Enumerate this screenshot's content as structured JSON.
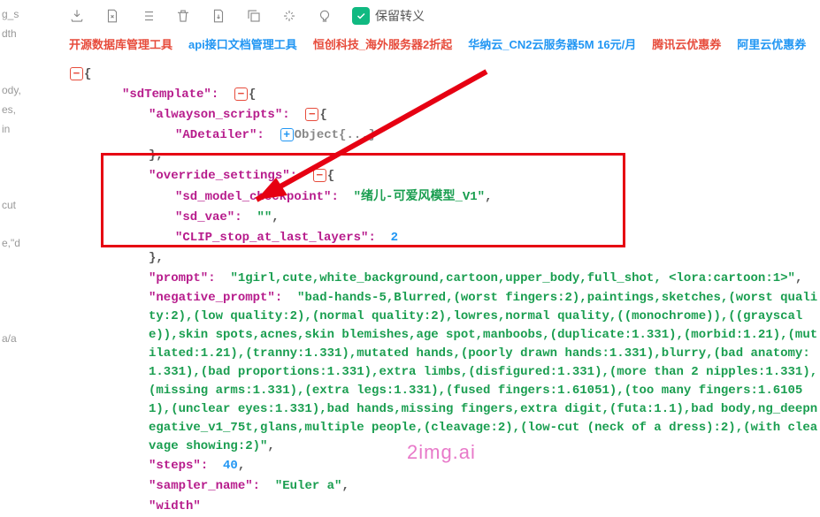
{
  "toolbar": {
    "checkbox_label": "保留转义"
  },
  "links": [
    {
      "text": "开源数据库管理工具",
      "cls": "link-red"
    },
    {
      "text": "api接口文档管理工具",
      "cls": "link-blue"
    },
    {
      "text": "恒创科技_海外服务器2折起",
      "cls": "link-red"
    },
    {
      "text": "华纳云_CN2云服务器5M 16元/月",
      "cls": "link-blue"
    },
    {
      "text": "腾讯云优惠券",
      "cls": "link-red"
    },
    {
      "text": "阿里云优惠券",
      "cls": "link-blue"
    }
  ],
  "json": {
    "sdTemplate_key": "\"sdTemplate\"",
    "alwayson_scripts_key": "\"alwayson_scripts\"",
    "adetailer_key": "\"ADetailer\"",
    "adetailer_stub": "Object{...}",
    "override_settings_key": "\"override_settings\"",
    "sd_model_checkpoint_key": "\"sd_model_checkpoint\"",
    "sd_model_checkpoint_val": "\"绪儿-可爱风模型_V1\"",
    "sd_vae_key": "\"sd_vae\"",
    "sd_vae_val": "\"\"",
    "clip_key": "\"CLIP_stop_at_last_layers\"",
    "clip_val": "2",
    "prompt_key": "\"prompt\"",
    "prompt_val": "\"1girl,cute,white_background,cartoon,upper_body,full_shot, <lora:cartoon:1>\"",
    "negative_prompt_key": "\"negative_prompt\"",
    "negative_prompt_val": "\"bad-hands-5,Blurred,(worst fingers:2),paintings,sketches,(worst quality:2),(low quality:2),(normal quality:2),lowres,normal quality,((monochrome)),((grayscale)),skin spots,acnes,skin blemishes,age spot,manboobs,(duplicate:1.331),(morbid:1.21),(mutilated:1.21),(tranny:1.331),mutated hands,(poorly drawn hands:1.331),blurry,(bad anatomy:1.331),(bad proportions:1.331),extra limbs,(disfigured:1.331),(more than 2 nipples:1.331),(missing arms:1.331),(extra legs:1.331),(fused fingers:1.61051),(too many fingers:1.61051),(unclear eyes:1.331),bad hands,missing fingers,extra digit,(futa:1.1),bad body,ng_deepnegative_v1_75t,glans,multiple people,(cleavage:2),(low-cut (neck of a dress):2),(with cleavage showing:2)\"",
    "steps_key": "\"steps\"",
    "steps_val": "40",
    "sampler_key": "\"sampler_name\"",
    "sampler_val": "\"Euler a\"",
    "width_key": "\"width\""
  },
  "left_fragments": [
    "g_s",
    "dth",
    "",
    "",
    "ody,",
    "es,",
    "in",
    "",
    "",
    "",
    "cut",
    "",
    "e,\"d",
    "",
    "",
    "",
    "",
    "a/a",
    "",
    ""
  ],
  "watermark": "2img.ai"
}
